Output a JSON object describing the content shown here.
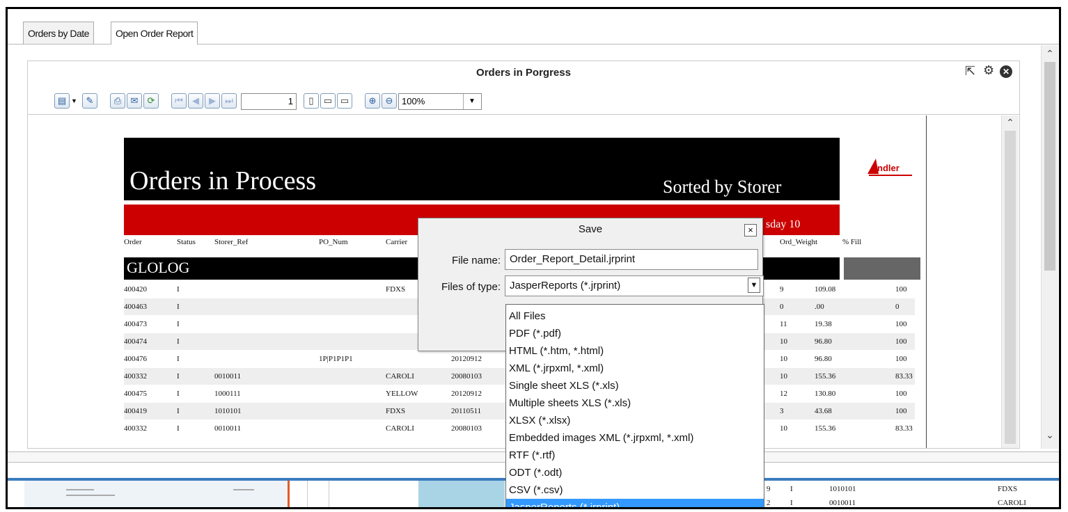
{
  "tabs": [
    {
      "label": "Orders by Date",
      "active": false
    },
    {
      "label": "Open Order Report",
      "active": true
    }
  ],
  "panel": {
    "title": "Orders in Porgress",
    "icons": [
      "popout-icon",
      "gear-icon",
      "close-icon"
    ]
  },
  "toolbar": {
    "page_number": "1",
    "zoom_value": "100%"
  },
  "report": {
    "title": "Orders in Process",
    "sorted_by": "Sorted by Storer",
    "date_fragment": "sday 10",
    "group": "GLOLOG",
    "columns": [
      "Order",
      "Status",
      "Storer_Ref",
      "PO_Num",
      "Carrier",
      "Ord_Weight",
      "% Fill"
    ],
    "rows": [
      {
        "order": "400420",
        "status": "I",
        "storer_ref": "",
        "po": "",
        "carrier": "FDXS",
        "date": "",
        "cnt": "9",
        "weight": "109.08",
        "fill": "100"
      },
      {
        "order": "400463",
        "status": "I",
        "storer_ref": "",
        "po": "",
        "carrier": "",
        "date": "",
        "cnt": "0",
        "weight": ".00",
        "fill": "0"
      },
      {
        "order": "400473",
        "status": "I",
        "storer_ref": "",
        "po": "",
        "carrier": "",
        "date": "",
        "cnt": "11",
        "weight": "19.38",
        "fill": "100"
      },
      {
        "order": "400474",
        "status": "I",
        "storer_ref": "",
        "po": "",
        "carrier": "",
        "date": "",
        "cnt": "10",
        "weight": "96.80",
        "fill": "100"
      },
      {
        "order": "400476",
        "status": "I",
        "storer_ref": "",
        "po": "1P|P1P1P1",
        "carrier": "",
        "date": "20120912",
        "cnt": "10",
        "weight": "96.80",
        "fill": "100"
      },
      {
        "order": "400332",
        "status": "I",
        "storer_ref": "0010011",
        "po": "",
        "carrier": "CAROLI",
        "date": "20080103",
        "cnt": "10",
        "weight": "155.36",
        "fill": "83.33"
      },
      {
        "order": "400475",
        "status": "I",
        "storer_ref": "1000111",
        "po": "",
        "carrier": "YELLOW",
        "date": "20120912",
        "cnt": "12",
        "weight": "130.80",
        "fill": "100"
      },
      {
        "order": "400419",
        "status": "I",
        "storer_ref": "1010101",
        "po": "",
        "carrier": "FDXS",
        "date": "20110511",
        "cnt": "3",
        "weight": "43.68",
        "fill": "100"
      },
      {
        "order": "400332",
        "status": "I",
        "storer_ref": "0010011",
        "po": "",
        "carrier": "CAROLI",
        "date": "20080103",
        "cnt": "10",
        "weight": "155.36",
        "fill": "83.33"
      }
    ]
  },
  "lower_rows": [
    {
      "cnt": "9",
      "status": "I",
      "ref": "1010101",
      "carrier": "FDXS"
    },
    {
      "cnt": "2",
      "status": "I",
      "ref": "0010011",
      "carrier": "CAROLI"
    }
  ],
  "dialog": {
    "title": "Save",
    "close_label": "×",
    "file_name_label": "File name:",
    "file_name_value": "Order_Report_Detail.jrprint",
    "file_type_label": "Files of type:",
    "file_type_value": "JasperReports (*.jrprint)",
    "options": [
      "All Files",
      "PDF (*.pdf)",
      "HTML (*.htm, *.html)",
      "XML (*.jrpxml, *.xml)",
      "Single sheet XLS (*.xls)",
      "Multiple sheets XLS (*.xls)",
      "XLSX (*.xlsx)",
      "Embedded images XML (*.jrpxml, *.xml)",
      "RTF (*.rtf)",
      "ODT (*.odt)",
      "CSV (*.csv)",
      "JasperReports (*.jrprint)"
    ],
    "selected_option": "JasperReports (*.jrprint)"
  },
  "colors": {
    "report_red": "#cc0000",
    "selection_blue": "#3399ff"
  }
}
